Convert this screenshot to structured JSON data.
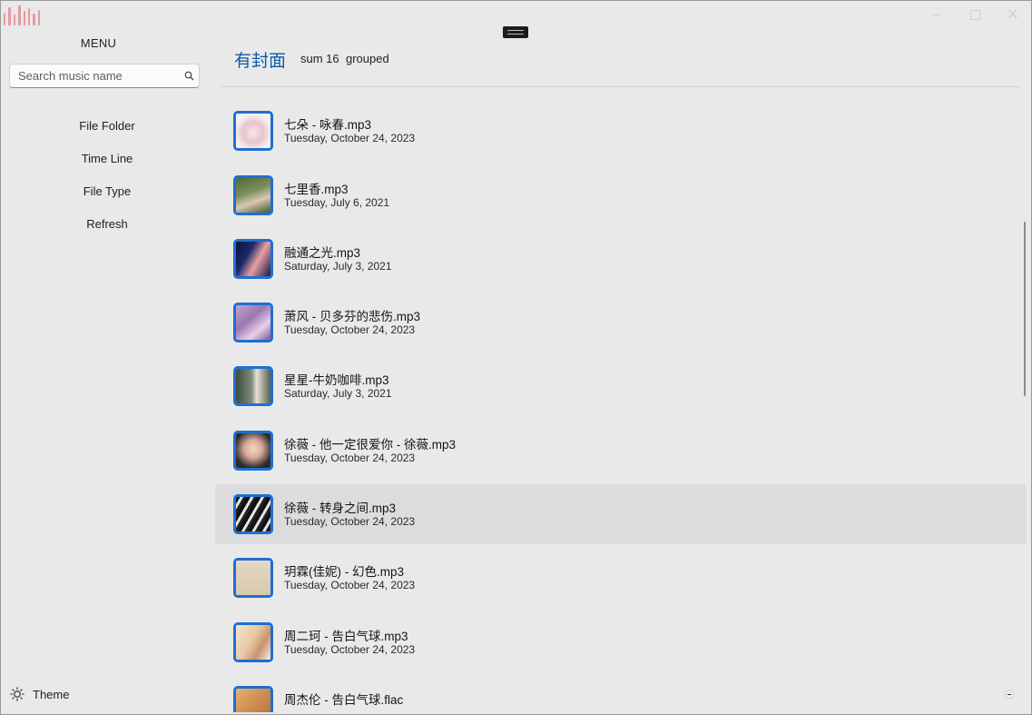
{
  "window": {
    "logo_icon": "app-logo-bars",
    "accent_color": "#1f6fd1",
    "title_color": "#0f5aa8"
  },
  "sidebar": {
    "menu_title": "MENU",
    "search_placeholder": "Search music name",
    "nav": [
      {
        "label": "File Folder"
      },
      {
        "label": "Time Line"
      },
      {
        "label": "File Type"
      },
      {
        "label": "Refresh"
      }
    ],
    "theme_label": "Theme"
  },
  "header": {
    "title": "有封面",
    "sum": "sum 16",
    "grouped": "grouped"
  },
  "songs": [
    {
      "title": "",
      "date": "Tuesday, October 24, 2023",
      "cover": "c0"
    },
    {
      "title": "七朵 - 咏春.mp3",
      "date": "Tuesday, October 24, 2023",
      "cover": "c1"
    },
    {
      "title": "七里香.mp3",
      "date": "Tuesday, July 6, 2021",
      "cover": "c2"
    },
    {
      "title": "融通之光.mp3",
      "date": "Saturday, July 3, 2021",
      "cover": "c3"
    },
    {
      "title": "萧风 - 贝多芬的悲伤.mp3",
      "date": "Tuesday, October 24, 2023",
      "cover": "c4"
    },
    {
      "title": "星星-牛奶咖啡.mp3",
      "date": "Saturday, July 3, 2021",
      "cover": "c5"
    },
    {
      "title": "徐薇 - 他一定很爱你 - 徐薇.mp3",
      "date": "Tuesday, October 24, 2023",
      "cover": "c6"
    },
    {
      "title": "徐薇 - 转身之间.mp3",
      "date": "Tuesday, October 24, 2023",
      "cover": "c7",
      "selected": true
    },
    {
      "title": "玥霖(佳妮) - 幻色.mp3",
      "date": "Tuesday, October 24, 2023",
      "cover": "c8"
    },
    {
      "title": "周二珂 - 告白气球.mp3",
      "date": "Tuesday, October 24, 2023",
      "cover": "c9"
    },
    {
      "title": "周杰伦 - 告白气球.flac",
      "date": "",
      "cover": "c10"
    }
  ]
}
